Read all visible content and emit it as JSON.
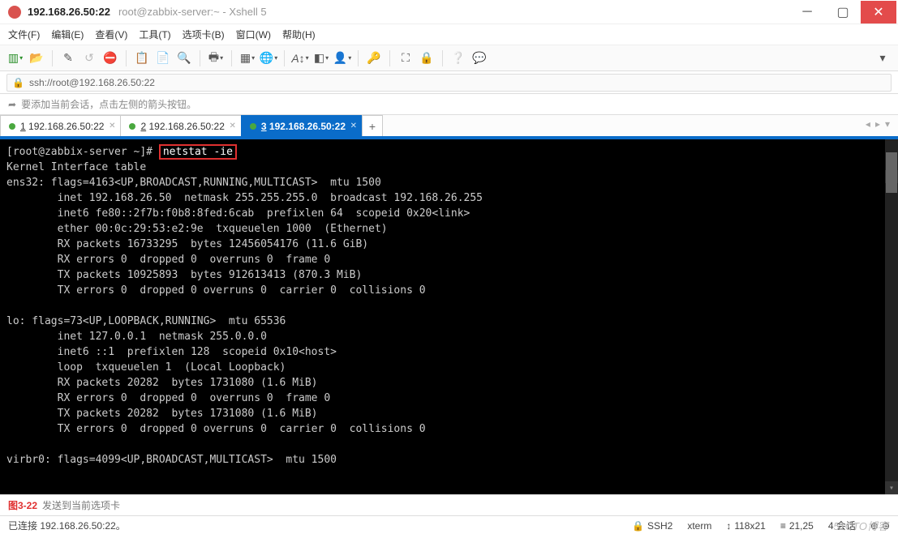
{
  "window": {
    "title_main": "192.168.26.50:22",
    "title_sub": "root@zabbix-server:~ - Xshell 5"
  },
  "menu": {
    "file": "文件(F)",
    "edit": "编辑(E)",
    "view": "查看(V)",
    "tools": "工具(T)",
    "tabs": "选项卡(B)",
    "window": "窗口(W)",
    "help": "帮助(H)"
  },
  "address": {
    "url": "ssh://root@192.168.26.50:22"
  },
  "hint": {
    "text": "要添加当前会话，点击左侧的箭头按钮。"
  },
  "tabs": {
    "t1_prefix": "1",
    "t1_rest": " 192.168.26.50:22",
    "t2_prefix": "2",
    "t2_rest": " 192.168.26.50:22",
    "t3_prefix": "3",
    "t3_rest": " 192.168.26.50:22"
  },
  "term": {
    "prompt": "[root@zabbix-server ~]# ",
    "cmd": "netstat -ie",
    "body": "Kernel Interface table\nens32: flags=4163<UP,BROADCAST,RUNNING,MULTICAST>  mtu 1500\n        inet 192.168.26.50  netmask 255.255.255.0  broadcast 192.168.26.255\n        inet6 fe80::2f7b:f0b8:8fed:6cab  prefixlen 64  scopeid 0x20<link>\n        ether 00:0c:29:53:e2:9e  txqueuelen 1000  (Ethernet)\n        RX packets 16733295  bytes 12456054176 (11.6 GiB)\n        RX errors 0  dropped 0  overruns 0  frame 0\n        TX packets 10925893  bytes 912613413 (870.3 MiB)\n        TX errors 0  dropped 0 overruns 0  carrier 0  collisions 0\n\nlo: flags=73<UP,LOOPBACK,RUNNING>  mtu 65536\n        inet 127.0.0.1  netmask 255.0.0.0\n        inet6 ::1  prefixlen 128  scopeid 0x10<host>\n        loop  txqueuelen 1  (Local Loopback)\n        RX packets 20282  bytes 1731080 (1.6 MiB)\n        RX errors 0  dropped 0  overruns 0  frame 0\n        TX packets 20282  bytes 1731080 (1.6 MiB)\n        TX errors 0  dropped 0 overruns 0  carrier 0  collisions 0\n\nvirbr0: flags=4099<UP,BROADCAST,MULTICAST>  mtu 1500"
  },
  "footer": {
    "fig": "图3-22",
    "hint": "发送到当前选项卡"
  },
  "status": {
    "conn": "已连接 192.168.26.50:22。",
    "proto": "SSH2",
    "termtype": "xterm",
    "size": "118x21",
    "cursor": "21,25",
    "sessions": "4 会话"
  },
  "watermark": "51CTO博客"
}
